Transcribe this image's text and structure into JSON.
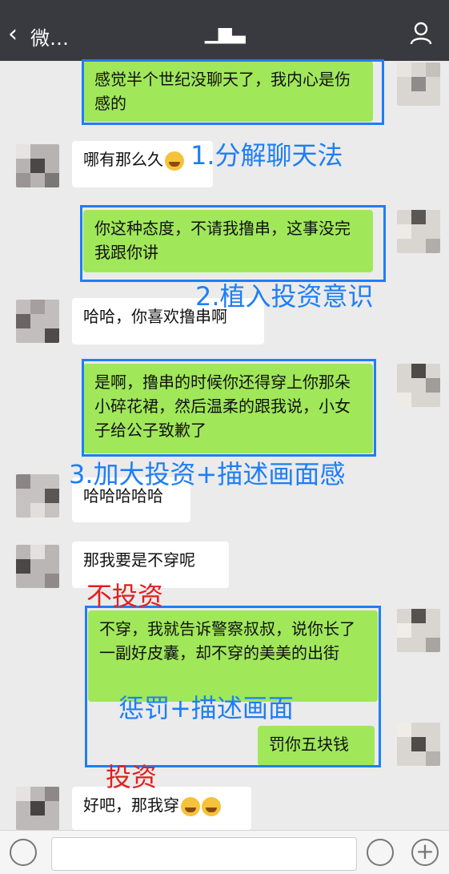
{
  "header": {
    "back_label": "微…",
    "title": " ▁▆▃",
    "colors": {
      "bar": "#393a3f",
      "text": "#ffffff"
    }
  },
  "messages": [
    {
      "side": "out",
      "text": "感觉半个世纪没聊天了，我内心是伤感的"
    },
    {
      "side": "in",
      "text": "哪有那么久",
      "emoji_count": 1
    },
    {
      "side": "out",
      "text": "你这种态度，不请我撸串，这事没完我跟你讲"
    },
    {
      "side": "in",
      "text": "哈哈，你喜欢撸串啊"
    },
    {
      "side": "out",
      "text": "是啊，撸串的时候你还得穿上你那朵小碎花裙，然后温柔的跟我说，小女子给公子致歉了"
    },
    {
      "side": "in",
      "text": "哈哈哈哈哈"
    },
    {
      "side": "in",
      "text": "那我要是不穿呢"
    },
    {
      "side": "out",
      "text": "不穿，我就告诉警察叔叔，说你长了一副好皮囊，却不穿的美美的出街"
    },
    {
      "side": "out",
      "text": "罚你五块钱"
    },
    {
      "side": "in",
      "text": "好吧，那我穿",
      "emoji_count": 2
    }
  ],
  "annotations": [
    {
      "text": "1.分解聊天法",
      "color": "#1e7ef5"
    },
    {
      "text": "2.植入投资意识",
      "color": "#1e7ef5"
    },
    {
      "text": "3.加大投资+描述画面感",
      "color": "#1e7ef5"
    },
    {
      "text": "不投资",
      "color": "#e02020"
    },
    {
      "text": "惩罚+描述画面",
      "color": "#1e7ef5"
    },
    {
      "text": "投资",
      "color": "#e02020"
    }
  ],
  "colors": {
    "outgoing_bubble": "#a0e75a",
    "incoming_bubble": "#ffffff",
    "annotation_blue": "#1e7ef5",
    "annotation_red": "#e02020",
    "background": "#ebebeb"
  },
  "icons": [
    "chevron-left-icon",
    "user-icon",
    "voice-icon",
    "emoji-icon",
    "plus-icon"
  ]
}
